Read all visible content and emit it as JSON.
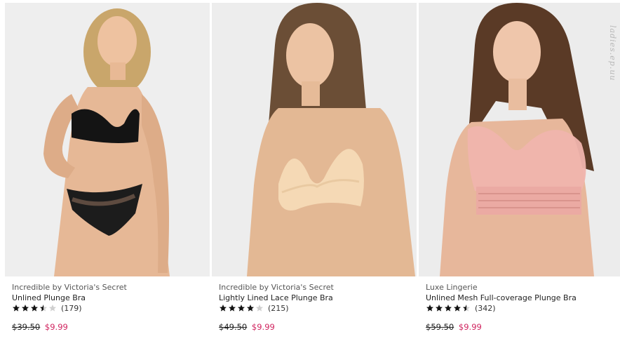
{
  "products": [
    {
      "brand": "Incredible by Victoria's Secret",
      "name": "Unlined Plunge Bra",
      "rating": 3.5,
      "review_count": "(179)",
      "original_price": "$39.50",
      "sale_price": "$9.99",
      "image_desc": "model in black bra"
    },
    {
      "brand": "Incredible by Victoria's Secret",
      "name": "Lightly Lined Lace Plunge Bra",
      "rating": 4,
      "review_count": "(215)",
      "original_price": "$49.50",
      "sale_price": "$9.99",
      "image_desc": "model in nude lace bra"
    },
    {
      "brand": "Luxe Lingerie",
      "name": "Unlined Mesh Full-coverage Plunge Bra",
      "rating": 4.5,
      "review_count": "(342)",
      "original_price": "$59.50",
      "sale_price": "$9.99",
      "image_desc": "model in pink mesh bra"
    }
  ],
  "watermark": "ladies.ep.uu",
  "colors": {
    "sale_price": "#d0245f",
    "star_filled": "#111111",
    "star_empty": "#cfcfcf",
    "photo_bg": "#ececec"
  }
}
